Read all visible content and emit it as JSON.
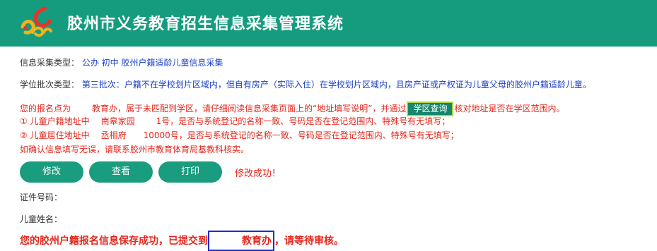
{
  "header": {
    "title": "胶州市义务教育招生信息采集管理系统",
    "logo_icon": "swirl-logo-icon",
    "bg_color": "#159c7e"
  },
  "info": {
    "type_label": "信息采集类型：",
    "type_value": "公办  初中  胶州户籍适龄儿童信息采集",
    "batch_label": "学位批次类型：",
    "batch_value": "第三批次：户籍不在学校划片区域内，但自有房产（实际入住）在学校划片区域内，且房产证或产权证为儿童父母的胶州户籍适龄儿童。"
  },
  "notice": {
    "line1_a": "您的报名点为",
    "line1_b": "教育办，属于未匹配到学区，请仔细阅读信息采集页面上的“地址填写说明”，并通过",
    "zone_button": "学区查询",
    "line1_c": "核对地址是否在学区范围内。",
    "line2_a": "①  儿童户籍地址中",
    "line2_b": "南皋家园",
    "line2_c": "1号",
    "line2_d": "，是否与系统登记的名称一致、号码是否在登记范围内、特殊号有无填写；",
    "line3_a": "②  儿童居住地址中",
    "line3_b": "丞相府",
    "line3_c": "10000号",
    "line3_d": "，是否与系统登记的名称一致、号码是否在登记范围内、特殊号有无填写；",
    "line4": "如确认信息填写无误，请联系胶州市教育体育局基教科核实。"
  },
  "actions": {
    "edit": "修改",
    "view": "查看",
    "print": "打印",
    "success": "修改成功！"
  },
  "fields": {
    "id_label": "证件号码：",
    "name_label": "儿童姓名："
  },
  "final": {
    "part1": "您的胶州户籍报名信息保存成功，已提交到",
    "boxed": "教育办",
    "part2": "，请等待审核。"
  }
}
